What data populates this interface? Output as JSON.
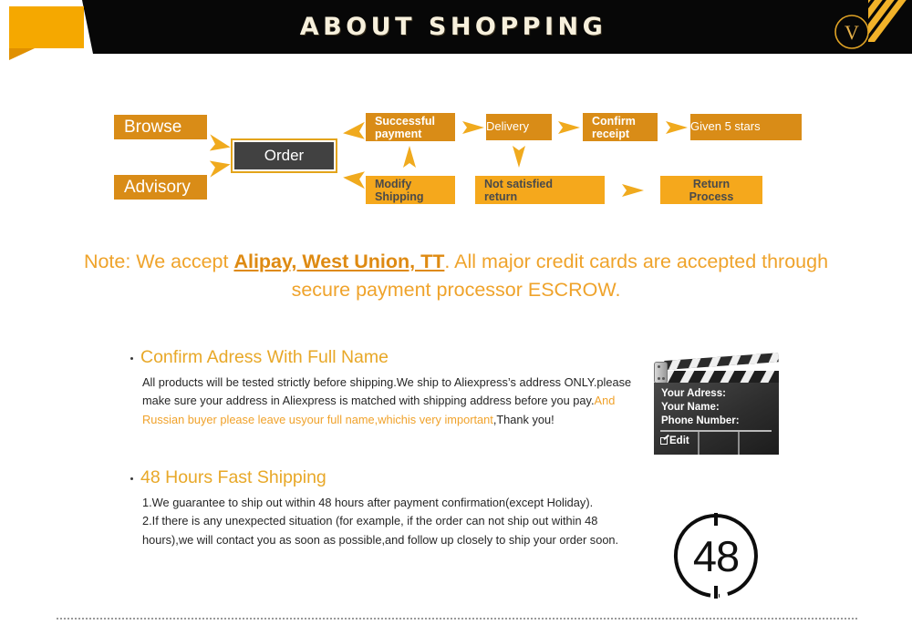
{
  "header": {
    "title": "ABOUT SHOPPING",
    "logo_letter": "V",
    "bar_color": "#070707",
    "tab_color": "#F5A800",
    "title_color": "#F7F0DC",
    "stripe_color": "#F2B229"
  },
  "flow": {
    "colors": {
      "top_row_box": "#D98C17",
      "bottom_row_box": "#F5A81C",
      "arrow": "#F0AA1E",
      "order_fill": "#414141",
      "order_border": "#E3A41A"
    },
    "nodes": [
      {
        "id": "browse",
        "label": "Browse"
      },
      {
        "id": "advisory",
        "label": "Advisory"
      },
      {
        "id": "order",
        "label": "Order"
      },
      {
        "id": "successful_payment",
        "label": "Successful\npayment"
      },
      {
        "id": "delivery",
        "label": "Delivery"
      },
      {
        "id": "confirm_receipt",
        "label": "Confirm\nreceipt"
      },
      {
        "id": "given_5_stars",
        "label": "Given 5 stars"
      },
      {
        "id": "modify_shipping",
        "label": "Modify\nShipping"
      },
      {
        "id": "not_satisfied_return",
        "label": "Not satisfied\nreturn"
      },
      {
        "id": "return_process",
        "label": "Return\nProcess"
      }
    ],
    "labels": {
      "browse": "Browse",
      "advisory": "Advisory",
      "order": "Order",
      "successful_payment_l1": "Successful",
      "successful_payment_l2": "payment",
      "delivery": "Delivery",
      "confirm_receipt_l1": "Confirm",
      "confirm_receipt_l2": "receipt",
      "given_5_stars": "Given 5 stars",
      "modify_shipping_l1": "Modify",
      "modify_shipping_l2": "Shipping",
      "not_satisfied_return_l1": "Not satisfied",
      "not_satisfied_return_l2": "return",
      "return_process_l1": "Return",
      "return_process_l2": "Process"
    }
  },
  "note": {
    "prefix": "Note:  We accept ",
    "emphasis": "Alipay, West Union, TT",
    "suffix": ". All major credit cards are accepted through secure payment processor ESCROW.",
    "color": "#EFA32B"
  },
  "sections": [
    {
      "heading": "Confirm Adress With Full Name",
      "body_1": "All products will be tested strictly before shipping.We ship to Aliexpress’s address ONLY.please make sure your address in Aliexpress is matched with shipping address before you pay.",
      "body_highlight": "And Russian buyer please leave usyour full name,whichis very important",
      "body_2": ",Thank you!"
    },
    {
      "heading": "48 Hours Fast Shipping",
      "body_1": "1.We guarantee to ship out within 48 hours after payment confirmation(except Holiday).",
      "body_2": "2.If there is any unexpected situation (for example, if the order can not ship out within 48 hours),we will contact you as soon as possible,and follow up closely to ship your order soon."
    }
  ],
  "clapperboard": {
    "line_1": "Your Adress:",
    "line_2": "Your Name:",
    "line_3": "Phone Number:",
    "edit_label": "Edit"
  },
  "clock": {
    "value": "48"
  }
}
